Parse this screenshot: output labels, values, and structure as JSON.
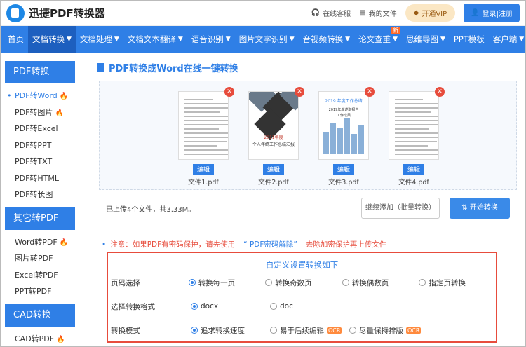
{
  "header": {
    "logo_text": "迅捷PDF转换器",
    "customer_service": "在线客服",
    "my_files": "我的文件",
    "vip_label": "开通VIP",
    "login_label": "登录|注册"
  },
  "nav": {
    "items": [
      {
        "label": "首页",
        "caret": false
      },
      {
        "label": "文档转换",
        "caret": true
      },
      {
        "label": "文档处理",
        "caret": true
      },
      {
        "label": "文档文本翻译",
        "caret": true
      },
      {
        "label": "语音识别",
        "caret": true
      },
      {
        "label": "图片文字识别",
        "caret": true
      },
      {
        "label": "音视频转换",
        "caret": true
      },
      {
        "label": "论文查重",
        "caret": true
      },
      {
        "label": "思维导图",
        "caret": true
      },
      {
        "label": "PPT模板",
        "caret": false
      },
      {
        "label": "客户端",
        "caret": true
      }
    ],
    "new_badge": "新",
    "caret_glyph": "▼"
  },
  "sidebar": {
    "group1_title": "PDF转换",
    "group1_items": [
      {
        "label": "PDF转Word",
        "hot": true,
        "active": true
      },
      {
        "label": "PDF转图片",
        "hot": true
      },
      {
        "label": "PDF转Excel"
      },
      {
        "label": "PDF转PPT"
      },
      {
        "label": "PDF转TXT"
      },
      {
        "label": "PDF转HTML"
      },
      {
        "label": "PDF转长图"
      }
    ],
    "group2_title": "其它转PDF",
    "group2_items": [
      {
        "label": "Word转PDF",
        "hot": true
      },
      {
        "label": "图片转PDF"
      },
      {
        "label": "Excel转PDF"
      },
      {
        "label": "PPT转PDF"
      }
    ],
    "group3_title": "CAD转换",
    "group3_items": [
      {
        "label": "CAD转PDF",
        "hot": true
      }
    ],
    "fire_glyph": "🔥"
  },
  "main": {
    "title": "PDF转换成Word在线一键转换",
    "edit_label": "编辑",
    "files": [
      {
        "name": "文件1.pdf"
      },
      {
        "name": "文件2.pdf",
        "thumb_line1": "2011年度",
        "thumb_line2": "个人年终工作总结汇报"
      },
      {
        "name": "文件3.pdf",
        "thumb_line1": "2019 年度工作总结",
        "thumb_line2": "2019年度述职报告",
        "thumb_line3": "工作成果"
      },
      {
        "name": "文件4.pdf"
      }
    ],
    "upload_info": "已上传4个文件，共3.33M。",
    "add_button": "继续添加（批量转换）",
    "start_button": "开始转换",
    "notice_text": "注意：如果PDF有密码保护，请先使用",
    "notice_link": "“ PDF密码解除”",
    "notice_after": "去除加密保护再上传文件"
  },
  "settings": {
    "title": "自定义设置转换如下",
    "rows": [
      {
        "label": "页码选择",
        "options": [
          {
            "text": "转换每一页",
            "on": true
          },
          {
            "text": "转换奇数页"
          },
          {
            "text": "转换偶数页"
          },
          {
            "text": "指定页转换"
          }
        ]
      },
      {
        "label": "选择转换格式",
        "options": [
          {
            "text": "docx",
            "on": true
          },
          {
            "text": "doc"
          }
        ]
      },
      {
        "label": "转换模式",
        "options": [
          {
            "text": "追求转换速度",
            "on": true
          },
          {
            "text": "易于后续编辑",
            "ocr": true
          },
          {
            "text": "尽量保持排版",
            "ocr": true
          }
        ]
      }
    ],
    "ocr_label": "OCR"
  },
  "colors": {
    "accent": "#2f7fe6",
    "danger": "#e74c3c",
    "hot": "#ff6a2a"
  }
}
